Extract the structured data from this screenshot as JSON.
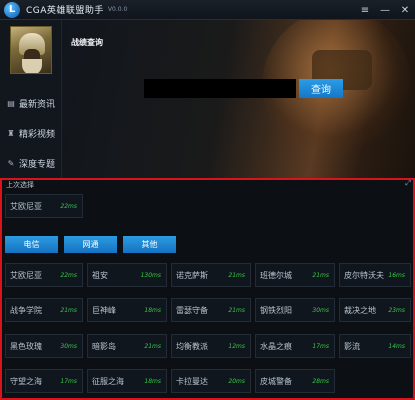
{
  "titlebar": {
    "logo_letter": "L",
    "title": "CGA英雄联盟助手",
    "version": "V0.0.0",
    "minimize_glyph": "—",
    "menu_glyph": "≡",
    "close_glyph": "✕"
  },
  "sidebar": {
    "items": [
      {
        "label": "最新资讯",
        "icon": "news-icon"
      },
      {
        "label": "精彩视频",
        "icon": "video-icon"
      },
      {
        "label": "深度专题",
        "icon": "topic-icon"
      }
    ]
  },
  "main": {
    "title": "战绩查询",
    "search": {
      "value": "",
      "placeholder": ""
    },
    "query_label": "查询"
  },
  "server_panel": {
    "heading": "上次选择",
    "last_selected": {
      "name": "艾欧尼亚",
      "ping": "22ms"
    },
    "tabs": [
      "电信",
      "网通",
      "其他"
    ],
    "servers": [
      {
        "name": "艾欧尼亚",
        "ping": "22ms"
      },
      {
        "name": "祖安",
        "ping": "130ms"
      },
      {
        "name": "诺克萨斯",
        "ping": "21ms"
      },
      {
        "name": "班德尔城",
        "ping": "21ms"
      },
      {
        "name": "皮尔特沃夫",
        "ping": "16ms"
      },
      {
        "name": "战争学院",
        "ping": "21ms"
      },
      {
        "name": "巨神峰",
        "ping": "18ms"
      },
      {
        "name": "雷瑟守备",
        "ping": "21ms"
      },
      {
        "name": "钢铁烈阳",
        "ping": "30ms"
      },
      {
        "name": "裁决之地",
        "ping": "23ms"
      },
      {
        "name": "黑色玫瑰",
        "ping": "30ms"
      },
      {
        "name": "暗影岛",
        "ping": "21ms"
      },
      {
        "name": "均衡教派",
        "ping": "12ms"
      },
      {
        "name": "水晶之痕",
        "ping": "17ms"
      },
      {
        "name": "影流",
        "ping": "14ms"
      },
      {
        "name": "守望之海",
        "ping": "17ms"
      },
      {
        "name": "征服之海",
        "ping": "18ms"
      },
      {
        "name": "卡拉曼达",
        "ping": "20ms"
      },
      {
        "name": "皮城警备",
        "ping": "28ms"
      }
    ]
  },
  "colors": {
    "accent_blue": "#1f8bd8",
    "ping_green": "#37c94a",
    "panel_border_red": "#d7141c"
  }
}
